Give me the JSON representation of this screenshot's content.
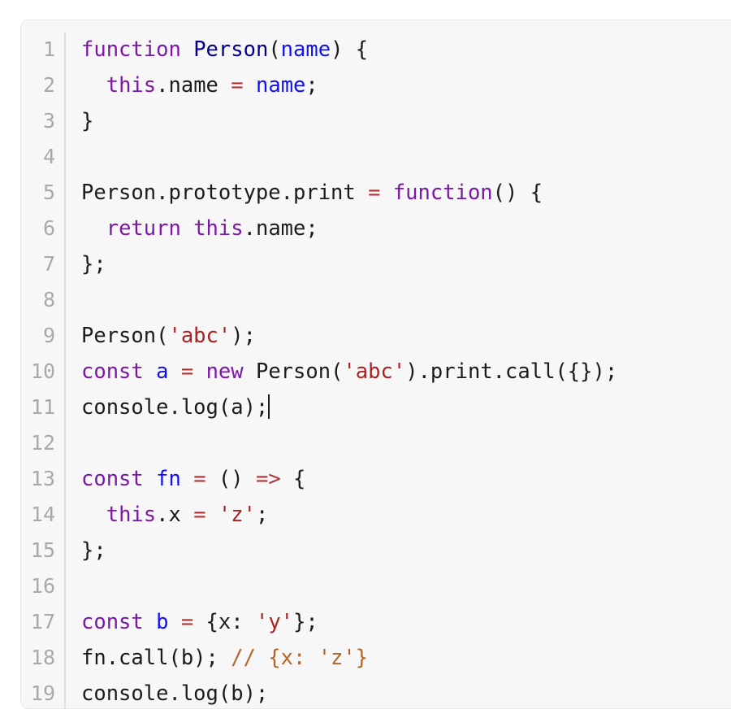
{
  "editor": {
    "language": "javascript",
    "cursor_line": 11,
    "total_lines": 19,
    "colors": {
      "background": "#f7f7f8",
      "page_background": "#ffffff",
      "border": "#e8e8ec",
      "gutter_text": "#a8a8ae",
      "gutter_divider": "#dddde1",
      "plain_text": "#1b1b1b",
      "keyword": "#7b18a8",
      "declaration": "#00008e",
      "variable": "#1010f0",
      "string": "#aa2222",
      "operator": "#b03333",
      "comment": "#b2662a",
      "caret": "#1b1b1b"
    },
    "lines": [
      {
        "number": "1",
        "tokens": [
          {
            "t": "function",
            "c": "kw"
          },
          {
            "t": " ",
            "c": "plain"
          },
          {
            "t": "Person",
            "c": "decl"
          },
          {
            "t": "(",
            "c": "plain"
          },
          {
            "t": "name",
            "c": "param"
          },
          {
            "t": ") {",
            "c": "plain"
          }
        ]
      },
      {
        "number": "2",
        "tokens": [
          {
            "t": "  ",
            "c": "plain"
          },
          {
            "t": "this",
            "c": "kw"
          },
          {
            "t": ".name ",
            "c": "plain"
          },
          {
            "t": "=",
            "c": "op"
          },
          {
            "t": " ",
            "c": "plain"
          },
          {
            "t": "name",
            "c": "var"
          },
          {
            "t": ";",
            "c": "plain"
          }
        ]
      },
      {
        "number": "3",
        "tokens": [
          {
            "t": "}",
            "c": "plain"
          }
        ]
      },
      {
        "number": "4",
        "tokens": []
      },
      {
        "number": "5",
        "tokens": [
          {
            "t": "Person.prototype.print ",
            "c": "plain"
          },
          {
            "t": "=",
            "c": "op"
          },
          {
            "t": " ",
            "c": "plain"
          },
          {
            "t": "function",
            "c": "kw"
          },
          {
            "t": "() {",
            "c": "plain"
          }
        ]
      },
      {
        "number": "6",
        "tokens": [
          {
            "t": "  ",
            "c": "plain"
          },
          {
            "t": "return",
            "c": "kw"
          },
          {
            "t": " ",
            "c": "plain"
          },
          {
            "t": "this",
            "c": "kw"
          },
          {
            "t": ".name;",
            "c": "plain"
          }
        ]
      },
      {
        "number": "7",
        "tokens": [
          {
            "t": "};",
            "c": "plain"
          }
        ]
      },
      {
        "number": "8",
        "tokens": []
      },
      {
        "number": "9",
        "tokens": [
          {
            "t": "Person(",
            "c": "plain"
          },
          {
            "t": "'abc'",
            "c": "str"
          },
          {
            "t": ");",
            "c": "plain"
          }
        ]
      },
      {
        "number": "10",
        "tokens": [
          {
            "t": "const",
            "c": "kw"
          },
          {
            "t": " ",
            "c": "plain"
          },
          {
            "t": "a",
            "c": "var"
          },
          {
            "t": " ",
            "c": "plain"
          },
          {
            "t": "=",
            "c": "op"
          },
          {
            "t": " ",
            "c": "plain"
          },
          {
            "t": "new",
            "c": "kw"
          },
          {
            "t": " Person(",
            "c": "plain"
          },
          {
            "t": "'abc'",
            "c": "str"
          },
          {
            "t": ").print.call({});",
            "c": "plain"
          }
        ]
      },
      {
        "number": "11",
        "tokens": [
          {
            "t": "console.log(a);",
            "c": "plain"
          }
        ],
        "caret_after": true
      },
      {
        "number": "12",
        "tokens": []
      },
      {
        "number": "13",
        "tokens": [
          {
            "t": "const",
            "c": "kw"
          },
          {
            "t": " ",
            "c": "plain"
          },
          {
            "t": "fn",
            "c": "var"
          },
          {
            "t": " ",
            "c": "plain"
          },
          {
            "t": "=",
            "c": "op"
          },
          {
            "t": " () ",
            "c": "plain"
          },
          {
            "t": "=>",
            "c": "op"
          },
          {
            "t": " {",
            "c": "plain"
          }
        ]
      },
      {
        "number": "14",
        "tokens": [
          {
            "t": "  ",
            "c": "plain"
          },
          {
            "t": "this",
            "c": "kw"
          },
          {
            "t": ".x ",
            "c": "plain"
          },
          {
            "t": "=",
            "c": "op"
          },
          {
            "t": " ",
            "c": "plain"
          },
          {
            "t": "'z'",
            "c": "str"
          },
          {
            "t": ";",
            "c": "plain"
          }
        ]
      },
      {
        "number": "15",
        "tokens": [
          {
            "t": "};",
            "c": "plain"
          }
        ]
      },
      {
        "number": "16",
        "tokens": []
      },
      {
        "number": "17",
        "tokens": [
          {
            "t": "const",
            "c": "kw"
          },
          {
            "t": " ",
            "c": "plain"
          },
          {
            "t": "b",
            "c": "var"
          },
          {
            "t": " ",
            "c": "plain"
          },
          {
            "t": "=",
            "c": "op"
          },
          {
            "t": " {x: ",
            "c": "plain"
          },
          {
            "t": "'y'",
            "c": "str"
          },
          {
            "t": "};",
            "c": "plain"
          }
        ]
      },
      {
        "number": "18",
        "tokens": [
          {
            "t": "fn.call(b); ",
            "c": "plain"
          },
          {
            "t": "// {x: 'z'}",
            "c": "comment"
          }
        ]
      },
      {
        "number": "19",
        "tokens": [
          {
            "t": "console.log(b);",
            "c": "plain"
          }
        ]
      }
    ]
  }
}
